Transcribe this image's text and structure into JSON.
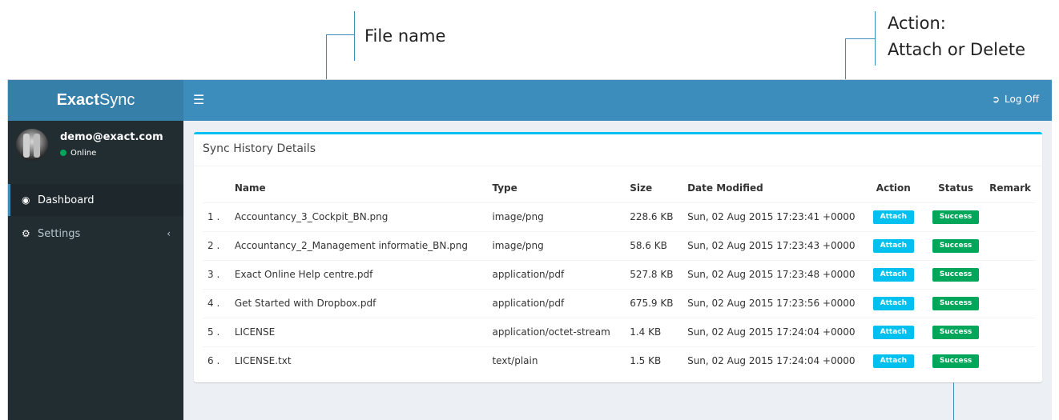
{
  "callouts": {
    "file_name": "File name",
    "action_line1": "Action:",
    "action_line2": "Attach or Delete"
  },
  "app": {
    "logo_bold": "Exact",
    "logo_rest": "Sync",
    "logoff_label": "Log Off"
  },
  "user": {
    "email": "demo@exact.com",
    "status": "Online"
  },
  "sidebar": {
    "items": [
      {
        "label": "Dashboard",
        "icon": "dashboard-icon"
      },
      {
        "label": "Settings",
        "icon": "cogs-icon"
      }
    ]
  },
  "box": {
    "title": "Sync History Details"
  },
  "table": {
    "headers": [
      "Name",
      "Type",
      "Size",
      "Date Modified",
      "Action",
      "Status",
      "Remark"
    ],
    "rows": [
      {
        "num": "1 .",
        "name": "Accountancy_3_Cockpit_BN.png",
        "type": "image/png",
        "size": "228.6 KB",
        "date": "Sun, 02 Aug 2015 17:23:41 +0000",
        "action": "Attach",
        "status": "Success",
        "remark": ""
      },
      {
        "num": "2 .",
        "name": "Accountancy_2_Management informatie_BN.png",
        "type": "image/png",
        "size": "58.6 KB",
        "date": "Sun, 02 Aug 2015 17:23:43 +0000",
        "action": "Attach",
        "status": "Success",
        "remark": ""
      },
      {
        "num": "3 .",
        "name": "Exact Online Help centre.pdf",
        "type": "application/pdf",
        "size": "527.8 KB",
        "date": "Sun, 02 Aug 2015 17:23:48 +0000",
        "action": "Attach",
        "status": "Success",
        "remark": ""
      },
      {
        "num": "4 .",
        "name": "Get Started with Dropbox.pdf",
        "type": "application/pdf",
        "size": "675.9 KB",
        "date": "Sun, 02 Aug 2015 17:23:56 +0000",
        "action": "Attach",
        "status": "Success",
        "remark": ""
      },
      {
        "num": "5 .",
        "name": "LICENSE",
        "type": "application/octet-stream",
        "size": "1.4 KB",
        "date": "Sun, 02 Aug 2015 17:24:04 +0000",
        "action": "Attach",
        "status": "Success",
        "remark": ""
      },
      {
        "num": "6 .",
        "name": "LICENSE.txt",
        "type": "text/plain",
        "size": "1.5 KB",
        "date": "Sun, 02 Aug 2015 17:24:04 +0000",
        "action": "Attach",
        "status": "Success",
        "remark": ""
      }
    ]
  },
  "colors": {
    "header_bg": "#3c8dbc",
    "logo_bg": "#367fa9",
    "sidebar_bg": "#222d32",
    "box_accent": "#00c0ef",
    "attach_label": "#00c0ef",
    "success_label": "#00a65a"
  }
}
